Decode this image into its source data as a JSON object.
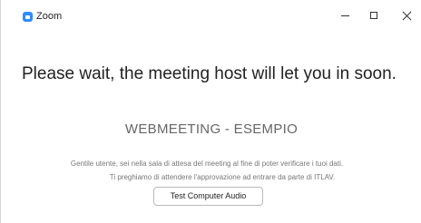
{
  "window": {
    "title": "Zoom",
    "brand_color": "#2d8cff",
    "controls": {
      "minimize_icon": "minimize-icon",
      "maximize_icon": "maximize-icon",
      "close_icon": "close-icon"
    }
  },
  "waiting_room": {
    "heading": "Please wait, the meeting host will let you in soon.",
    "meeting_name": "WEBMEETING - ESEMPIO",
    "message_lines": [
      "Gentile utente, sei nella sala di attesa del meeting al fine di poter verificare i tuoi dati.",
      "Ti preghiamo di attendere l'approvazione ad entrare da parte di ITLAV."
    ],
    "test_audio_label": "Test Computer Audio"
  }
}
